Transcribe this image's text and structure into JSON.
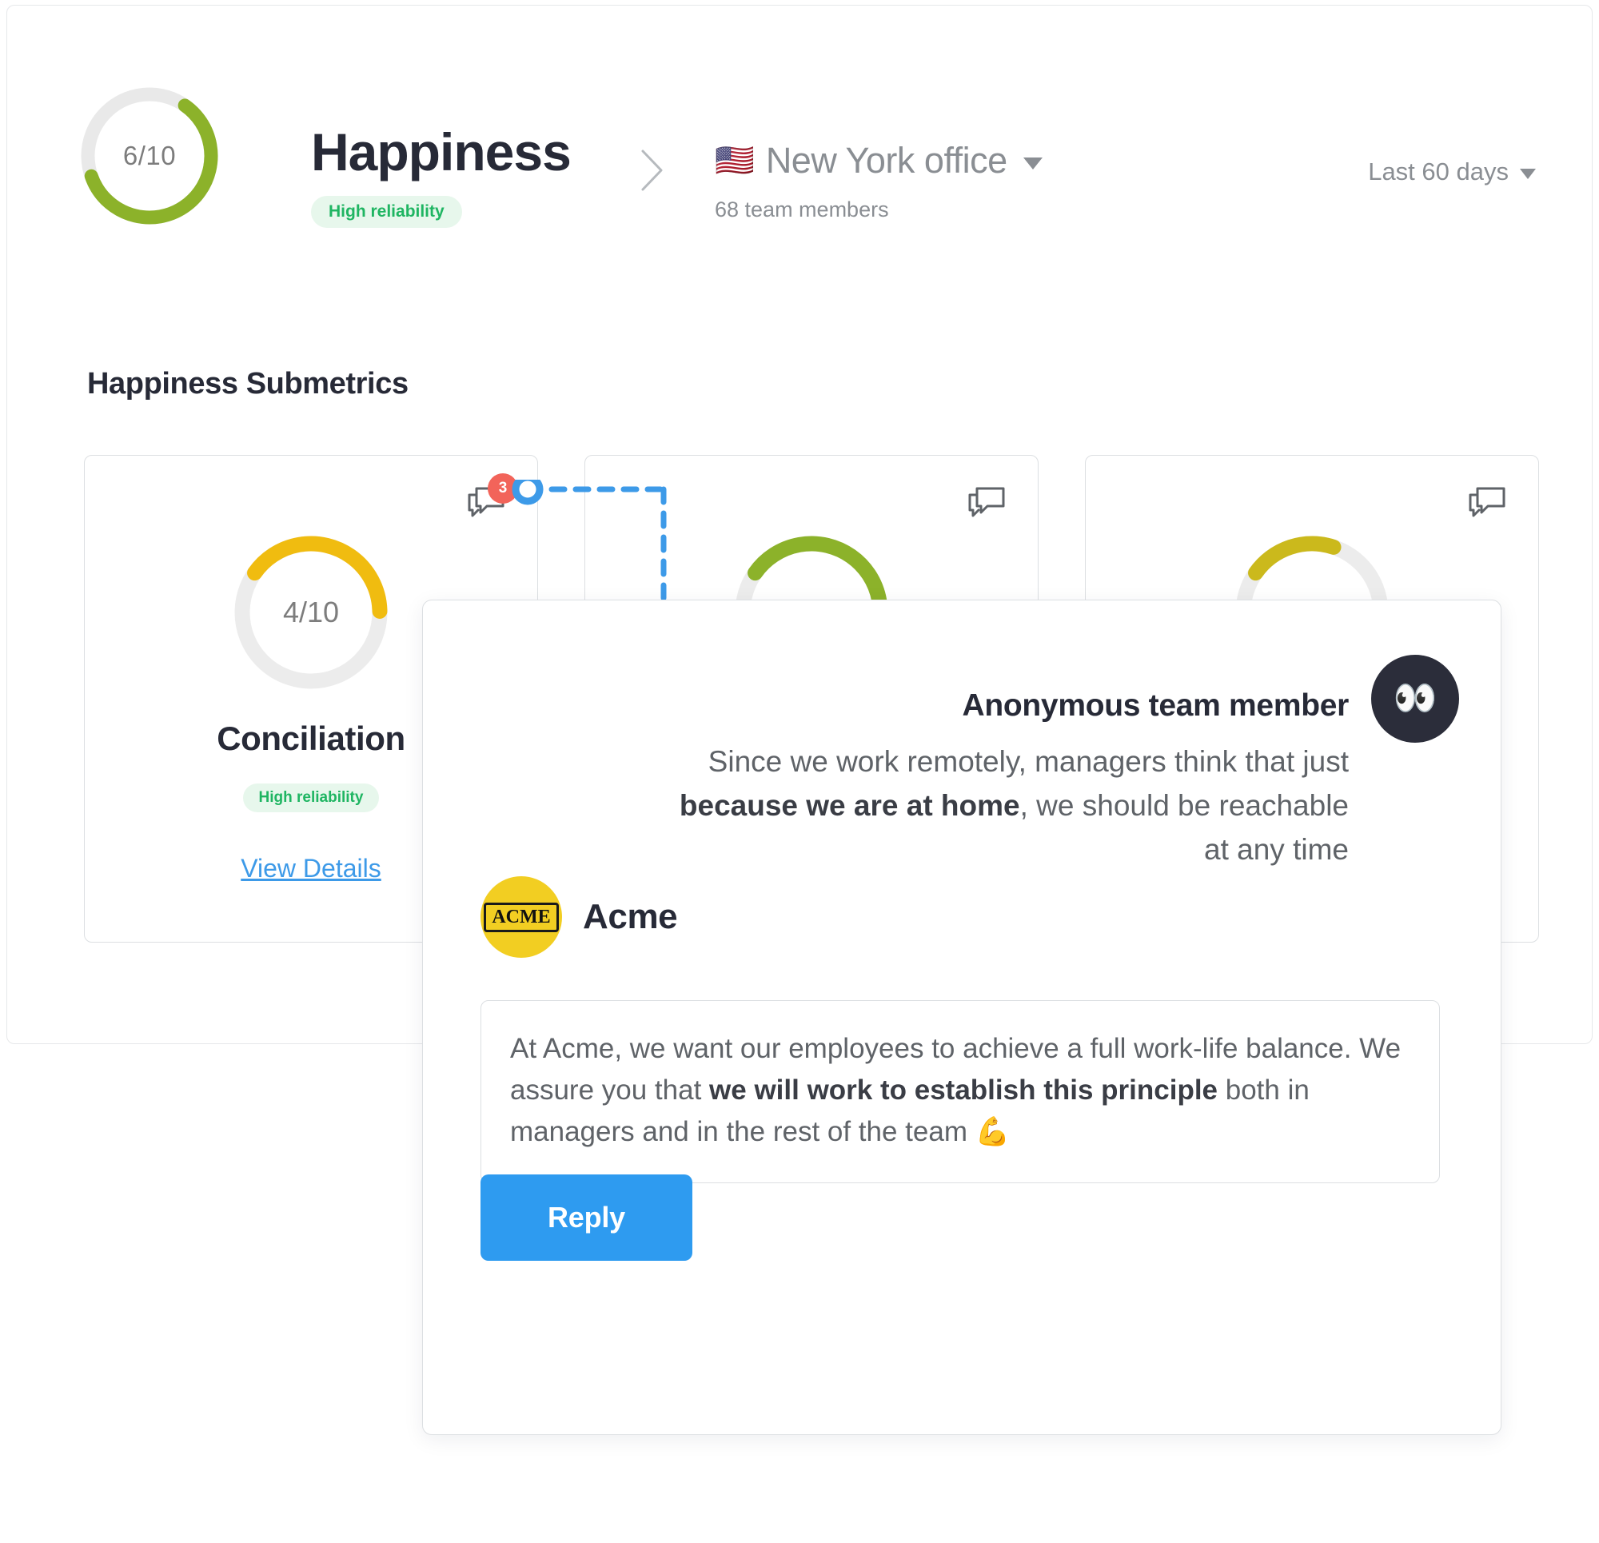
{
  "header": {
    "score_gauge": {
      "label": "6/10",
      "value": 6,
      "max": 10,
      "color": "#8cb22a"
    },
    "title": "Happiness",
    "reliability_pill": "High reliability",
    "breadcrumb_separator_icon": "chevron-right-icon",
    "scope": {
      "flag": "🇺🇸",
      "name": "New York office",
      "members": "68 team members"
    },
    "range": {
      "label": "Last 60 days"
    }
  },
  "section": {
    "title": "Happiness Submetrics"
  },
  "cards": [
    {
      "comment_icon": "comments-icon",
      "comment_count": "3",
      "gauge": {
        "label": "4/10",
        "value": 4,
        "max": 10,
        "color": "#f0bc10"
      },
      "name": "Conciliation",
      "reliability": "High reliability",
      "link": "View Details"
    },
    {
      "comment_icon": "comments-icon",
      "comment_count": "",
      "gauge": {
        "label": "",
        "value": 6,
        "max": 10,
        "color": "#8cb22a"
      },
      "name": "",
      "reliability": "",
      "link": ""
    },
    {
      "comment_icon": "comments-icon",
      "comment_count": "",
      "gauge": {
        "label": "",
        "value": 2,
        "max": 10,
        "color": "#cbb91c"
      },
      "name": "",
      "reliability": "",
      "link": ""
    }
  ],
  "popup": {
    "anonymous": {
      "avatar_icon": "eyes-emoji",
      "avatar_emoji": "👀",
      "name": "Anonymous team member",
      "message_part1": "Since we work remotely, managers think that just ",
      "message_bold": "because we are at home",
      "message_part2": ", we should be reachable at any time"
    },
    "brand": {
      "logo_text": "ACME",
      "name": "Acme"
    },
    "reply_text": {
      "part1": "At Acme, we want our employees to achieve a full work-life balance. We assure you that ",
      "bold": "we will work to establish this principle",
      "part2": " both in managers and in the rest of the team 💪"
    },
    "reply_button": "Reply"
  },
  "colors": {
    "accent_blue": "#2e9bf0",
    "green": "#8cb22a",
    "yellow": "#f0bc10",
    "badge_red": "#f2645a",
    "pill_green_text": "#1fb562",
    "pill_green_bg": "#e7f7ec"
  }
}
